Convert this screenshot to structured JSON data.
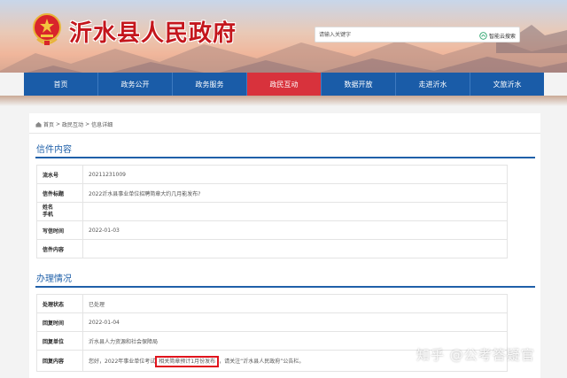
{
  "header": {
    "site_title": "沂水县人民政府",
    "search_placeholder": "请输入关键字",
    "search_button": "智能云搜索"
  },
  "nav": {
    "items": [
      {
        "label": "首页"
      },
      {
        "label": "政务公开"
      },
      {
        "label": "政务服务"
      },
      {
        "label": "政民互动",
        "active": true
      },
      {
        "label": "数据开放"
      },
      {
        "label": "走进沂水"
      },
      {
        "label": "文旅沂水"
      }
    ],
    "active_color": "#d8323c",
    "bar_color": "#1a5ca8"
  },
  "breadcrumb": {
    "items": [
      "首页",
      "政民互动",
      "信息详细"
    ],
    "separator": ">"
  },
  "letter": {
    "section_title": "信件内容",
    "rows": [
      {
        "key": "流水号",
        "value": "20211231009"
      },
      {
        "key": "信件标题",
        "value": "2022沂水县事业单位招聘简章大约几月能发布?"
      },
      {
        "key": "姓名\n手机",
        "value": ""
      },
      {
        "key": "写信时间",
        "value": "2022-01-03"
      },
      {
        "key": "信件内容",
        "value": ""
      }
    ]
  },
  "handling": {
    "section_title": "办理情况",
    "rows": [
      {
        "key": "处理状态",
        "value": "已处理"
      },
      {
        "key": "回复时间",
        "value": "2022-01-04"
      },
      {
        "key": "回复单位",
        "value": "沂水县人力资源和社会保障局"
      }
    ],
    "reply_key": "回复内容",
    "reply_prefix": "您好，2022年事业单位考试",
    "reply_highlight": "相关简章预计1月份发布",
    "reply_suffix": "，请关注“沂水县人民政府”公告栏。"
  },
  "watermark": "知乎 @公考答疑官"
}
